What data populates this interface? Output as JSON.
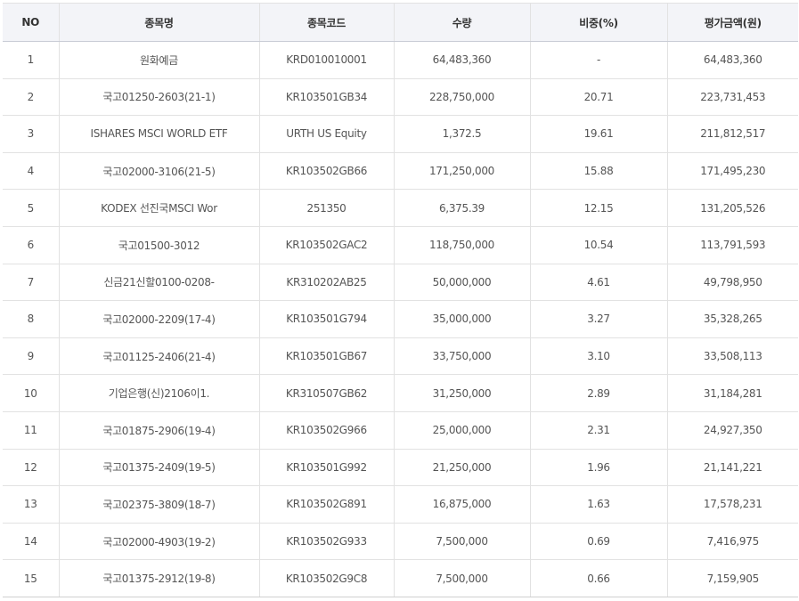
{
  "table": {
    "columns": [
      "NO",
      "종목명",
      "종목코드",
      "수량",
      "비중(%)",
      "평가금액(원)"
    ],
    "rows": [
      {
        "no": "1",
        "name": "원화예금",
        "code": "KRD010010001",
        "quantity": "64,483,360",
        "weight": "-",
        "value": "64,483,360"
      },
      {
        "no": "2",
        "name": "국고01250-2603(21-1)",
        "code": "KR103501GB34",
        "quantity": "228,750,000",
        "weight": "20.71",
        "value": "223,731,453"
      },
      {
        "no": "3",
        "name": "ISHARES MSCI WORLD ETF",
        "code": "URTH US Equity",
        "quantity": "1,372.5",
        "weight": "19.61",
        "value": "211,812,517"
      },
      {
        "no": "4",
        "name": "국고02000-3106(21-5)",
        "code": "KR103502GB66",
        "quantity": "171,250,000",
        "weight": "15.88",
        "value": "171,495,230"
      },
      {
        "no": "5",
        "name": "KODEX 선진국MSCI Wor",
        "code": "251350",
        "quantity": "6,375.39",
        "weight": "12.15",
        "value": "131,205,526"
      },
      {
        "no": "6",
        "name": "국고01500-3012",
        "code": "KR103502GAC2",
        "quantity": "118,750,000",
        "weight": "10.54",
        "value": "113,791,593"
      },
      {
        "no": "7",
        "name": "신금21신할0100-0208-",
        "code": "KR310202AB25",
        "quantity": "50,000,000",
        "weight": "4.61",
        "value": "49,798,950"
      },
      {
        "no": "8",
        "name": "국고02000-2209(17-4)",
        "code": "KR103501G794",
        "quantity": "35,000,000",
        "weight": "3.27",
        "value": "35,328,265"
      },
      {
        "no": "9",
        "name": "국고01125-2406(21-4)",
        "code": "KR103501GB67",
        "quantity": "33,750,000",
        "weight": "3.10",
        "value": "33,508,113"
      },
      {
        "no": "10",
        "name": "기업은행(신)2106이1.",
        "code": "KR310507GB62",
        "quantity": "31,250,000",
        "weight": "2.89",
        "value": "31,184,281"
      },
      {
        "no": "11",
        "name": "국고01875-2906(19-4)",
        "code": "KR103502G966",
        "quantity": "25,000,000",
        "weight": "2.31",
        "value": "24,927,350"
      },
      {
        "no": "12",
        "name": "국고01375-2409(19-5)",
        "code": "KR103501G992",
        "quantity": "21,250,000",
        "weight": "1.96",
        "value": "21,141,221"
      },
      {
        "no": "13",
        "name": "국고02375-3809(18-7)",
        "code": "KR103502G891",
        "quantity": "16,875,000",
        "weight": "1.63",
        "value": "17,578,231"
      },
      {
        "no": "14",
        "name": "국고02000-4903(19-2)",
        "code": "KR103502G933",
        "quantity": "7,500,000",
        "weight": "0.69",
        "value": "7,416,975"
      },
      {
        "no": "15",
        "name": "국고01375-2912(19-8)",
        "code": "KR103502G9C8",
        "quantity": "7,500,000",
        "weight": "0.66",
        "value": "7,159,905"
      }
    ]
  },
  "colors": {
    "header_background": "#f3f4f8",
    "border": "#e2e2e2",
    "text": "#555555",
    "header_text": "#333333"
  }
}
